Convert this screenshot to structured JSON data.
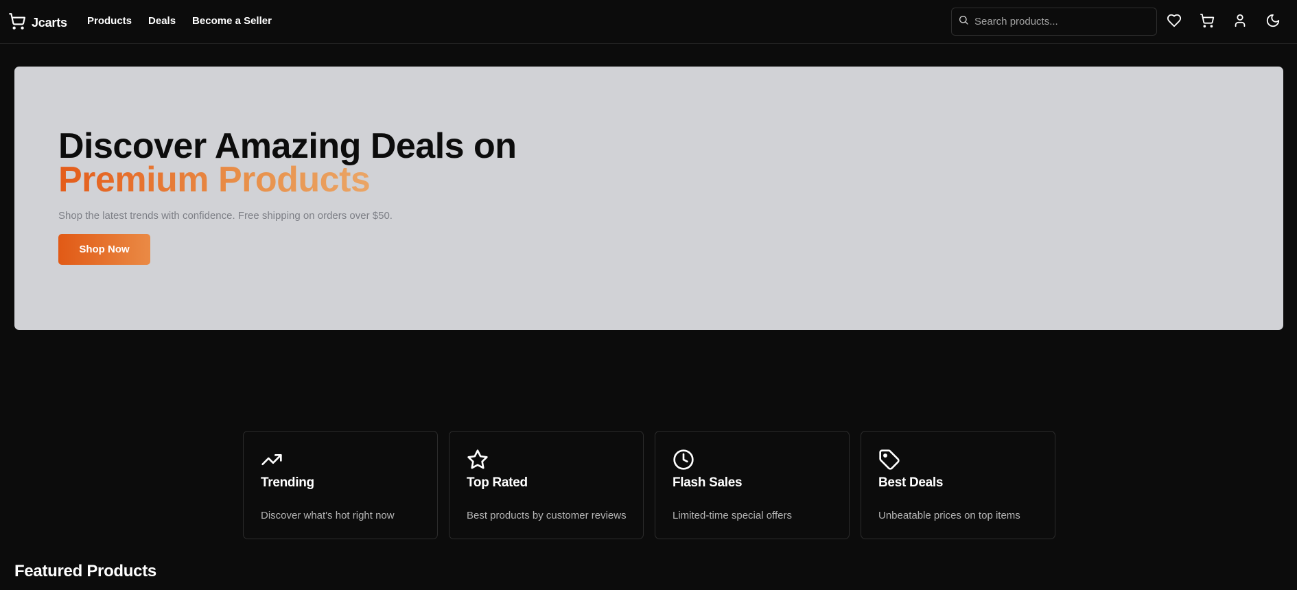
{
  "header": {
    "brand": "Jcarts",
    "nav": [
      "Products",
      "Deals",
      "Become a Seller"
    ],
    "search_placeholder": "Search products...",
    "icons": [
      "heart-icon",
      "cart-icon",
      "user-icon",
      "moon-icon"
    ]
  },
  "hero": {
    "title_line1": "Discover Amazing Deals on",
    "title_line2": "Premium Products",
    "subtitle": "Shop the latest trends with confidence. Free shipping on orders over $50.",
    "cta": "Shop Now"
  },
  "features": [
    {
      "icon": "trending-up-icon",
      "title": "Trending",
      "desc": "Discover what's hot right now"
    },
    {
      "icon": "star-icon",
      "title": "Top Rated",
      "desc": "Best products by customer reviews"
    },
    {
      "icon": "clock-icon",
      "title": "Flash Sales",
      "desc": "Limited-time special offers"
    },
    {
      "icon": "tag-icon",
      "title": "Best Deals",
      "desc": "Unbeatable prices on top items"
    }
  ],
  "featured": {
    "title": "Featured Products"
  },
  "colors": {
    "background": "#0c0c0c",
    "hero_bg": "#d1d2d6",
    "accent_start": "#e15a16",
    "accent_end": "#ea8a45"
  }
}
